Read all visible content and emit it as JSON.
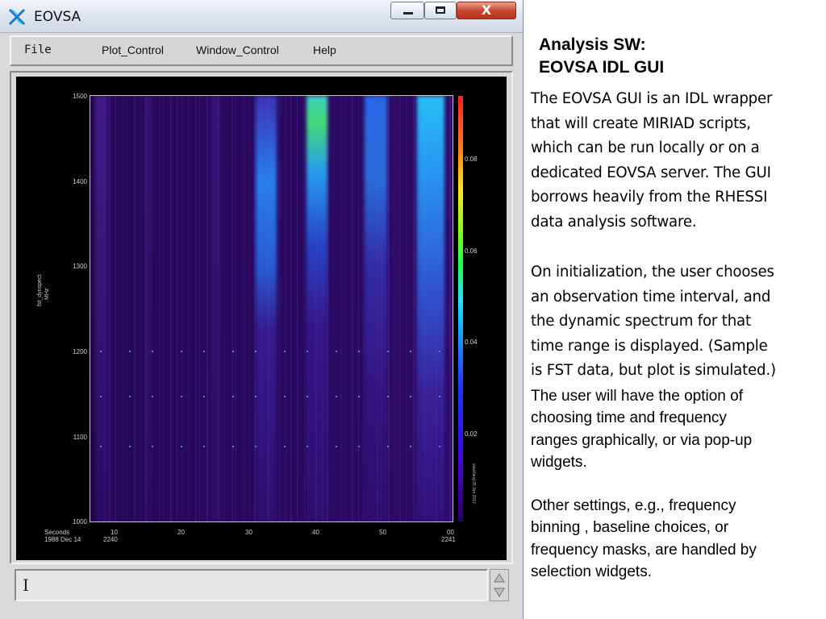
{
  "window": {
    "title": "EOVSA",
    "controls": {
      "minimize": "minimize",
      "maximize": "maximize",
      "close": "X"
    }
  },
  "menu": {
    "items": [
      {
        "label": "File"
      },
      {
        "label": "Plot_Control"
      },
      {
        "label": "Window_Control"
      },
      {
        "label": "Help"
      }
    ]
  },
  "plot": {
    "y_ticks": [
      "1500",
      "1400",
      "1300",
      "1200",
      "1100",
      "1000"
    ],
    "x_ticks": [
      "10",
      "20",
      "30",
      "40",
      "50",
      "00"
    ],
    "y_label_line1": "fst_dynspect",
    "y_label_line2": "MHz",
    "x_label_left_line1": "Seconds",
    "x_label_left_line2": "1988 Dec 14",
    "x_label_start": "2240",
    "x_label_end": "2241",
    "colorbar_ticks": [
      "0.08",
      "0.06",
      "0.04",
      "0.02"
    ],
    "colorbar_side_text": "slew/lang 05 Jan 2012"
  },
  "chart_data": {
    "type": "heatmap",
    "x": [
      "10",
      "20",
      "30",
      "40",
      "50",
      "00"
    ],
    "y": [
      1000,
      1100,
      1200,
      1300,
      1400,
      1500
    ],
    "ylim": [
      1000,
      1500
    ],
    "ylabel": "fst_dynspect MHz",
    "xlabel": "Seconds 1988 Dec 14",
    "colorbar_range": [
      0.02,
      0.08
    ],
    "colors": {
      "low": "#2a0a62",
      "mid": "#1e5fff",
      "high": "#ff1e1e"
    }
  },
  "textarea": {
    "value": "I"
  },
  "side": {
    "heading_line1": "Analysis SW:",
    "heading_line2": "EOVSA IDL GUI",
    "p1": [
      "The EOVSA GUI is an IDL wrapper",
      "that will create MIRIAD scripts,",
      "which can be run locally or on a",
      "dedicated EOVSA server.  The GUI",
      "borrows heavily from the RHESSI",
      "data analysis software."
    ],
    "p2": [
      "On initialization, the user chooses",
      "an observation time interval, and",
      "the dynamic spectrum for that",
      "time range is displayed. (Sample",
      "is FST data, but plot is simulated.)"
    ],
    "p3": [
      "The user will have the option of",
      "choosing time and frequency",
      "ranges graphically, or via pop-up",
      "widgets."
    ],
    "p4": [
      "Other settings, e.g., frequency",
      "binning , baseline choices, or",
      "frequency masks, are handled by",
      "selection widgets."
    ]
  }
}
